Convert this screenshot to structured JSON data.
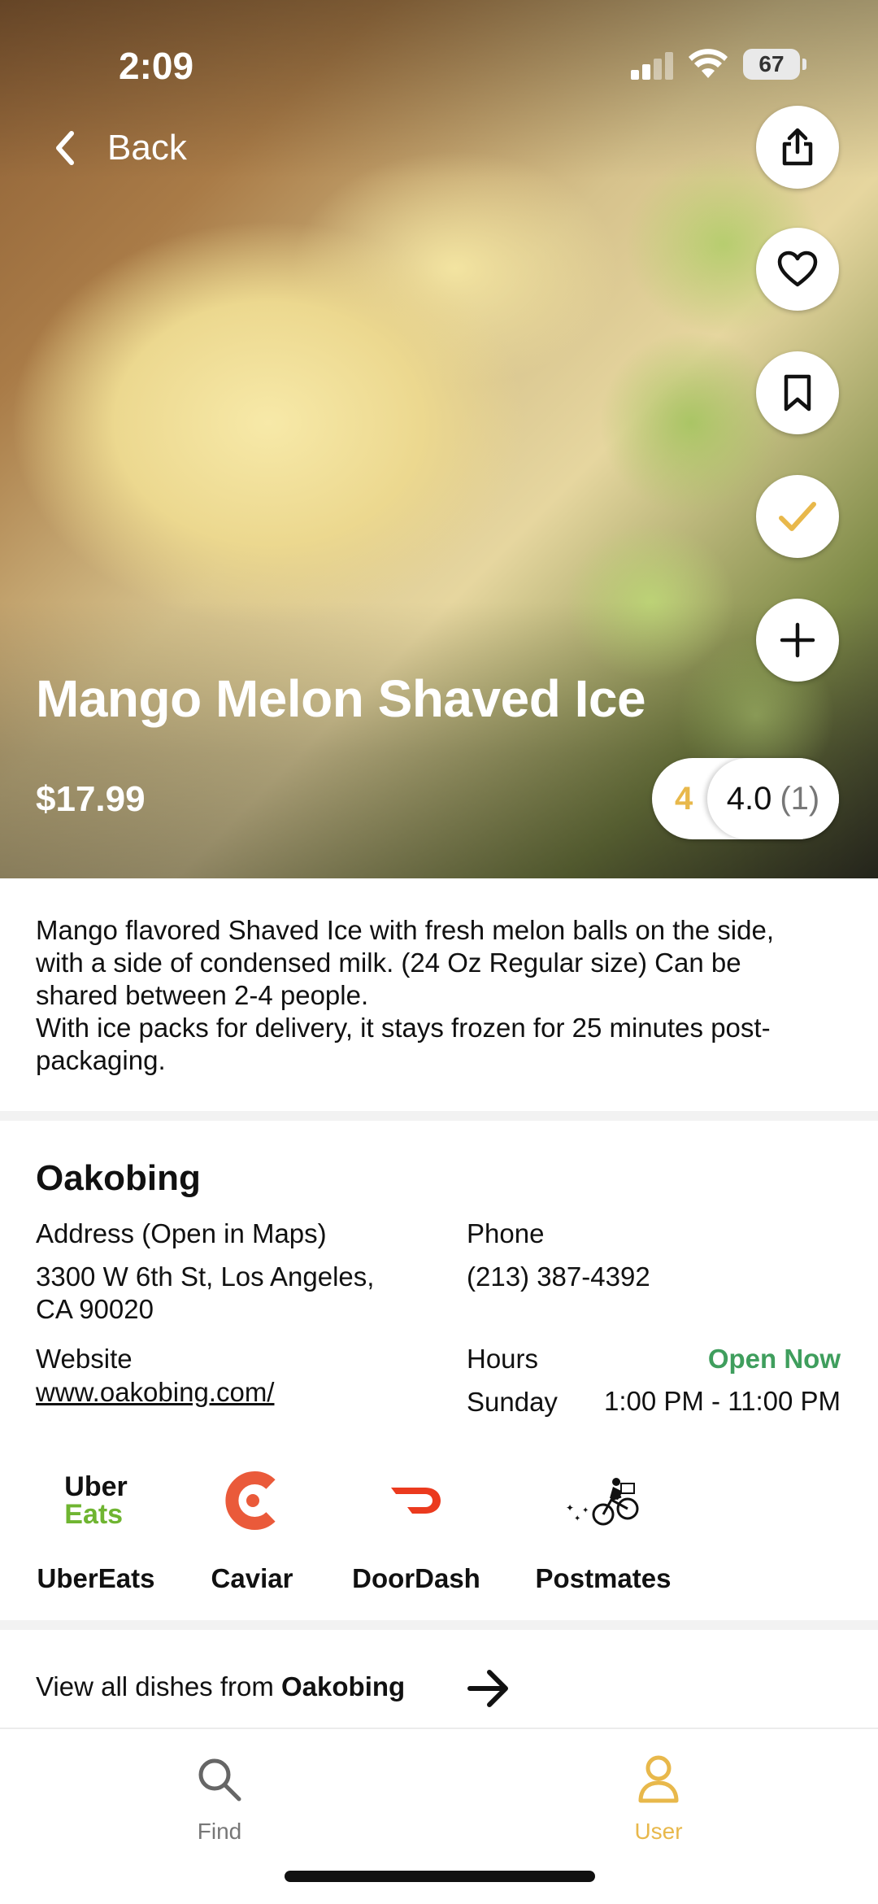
{
  "status_bar": {
    "time": "2:09",
    "battery": "67"
  },
  "nav": {
    "back_label": "Back"
  },
  "actions": [
    {
      "name": "share",
      "icon": "share-icon"
    },
    {
      "name": "favorite",
      "icon": "heart-icon"
    },
    {
      "name": "bookmark",
      "icon": "bookmark-icon"
    },
    {
      "name": "tried",
      "icon": "check-icon"
    },
    {
      "name": "add",
      "icon": "plus-icon"
    }
  ],
  "dish": {
    "title": "Mango Melon Shaved Ice",
    "price": "$17.99",
    "my_rating": "4",
    "avg_rating": "4.0",
    "rating_count": "(1)",
    "description_lines": [
      "Mango flavored Shaved Ice with fresh melon balls on the side,",
      "with a side of condensed milk. (24 Oz Regular size) Can be",
      "shared between 2-4 people.",
      "With ice packs for delivery, it stays frozen for 25 minutes post-",
      "packaging."
    ]
  },
  "restaurant": {
    "name": "Oakobing",
    "address_label": "Address (Open in Maps)",
    "address_line1": "3300 W 6th St, Los Angeles,",
    "address_line2": "CA 90020",
    "phone_label": "Phone",
    "phone": "(213) 387-4392",
    "website_label": "Website",
    "website": "www.oakobing.com/",
    "hours_label": "Hours",
    "open_status": "Open Now",
    "hours_day": "Sunday",
    "hours_time": "1:00 PM - 11:00 PM"
  },
  "delivery": {
    "uber_logo_top": "Uber",
    "uber_logo_bottom": "Eats",
    "services": [
      "UberEats",
      "Caviar",
      "DoorDash",
      "Postmates"
    ]
  },
  "view_all": {
    "prefix": "View all dishes from ",
    "restaurant": "Oakobing"
  },
  "tabs": [
    {
      "label": "Find",
      "icon": "search-icon",
      "active": false
    },
    {
      "label": "User",
      "icon": "user-icon",
      "active": true
    }
  ],
  "colors": {
    "accent": "#e8b84b",
    "open_green": "#3f9e5d",
    "caviar": "#ea5a3a",
    "doordash": "#eb3a1e",
    "uber_green": "#6fb531"
  }
}
